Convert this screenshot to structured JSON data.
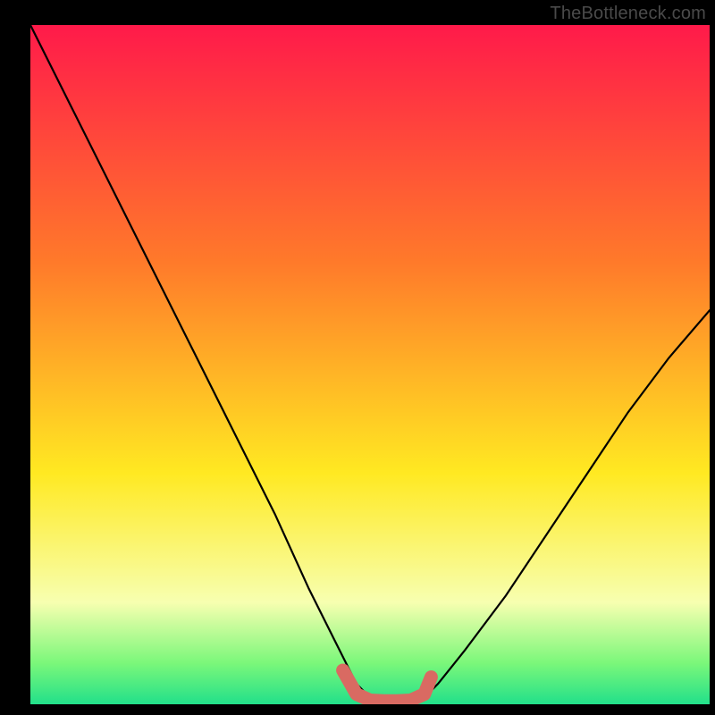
{
  "watermark": "TheBottleneck.com",
  "colors": {
    "frame": "#000000",
    "gradient_top": "#ff1a4a",
    "gradient_mid1": "#ff7a2a",
    "gradient_mid2": "#ffe922",
    "gradient_bottom1": "#f7ffb0",
    "gradient_bottom2": "#7af77a",
    "gradient_bottom3": "#22e08a",
    "curve": "#000000",
    "highlight": "#d96a62"
  },
  "chart_data": {
    "type": "line",
    "title": "",
    "xlabel": "",
    "ylabel": "",
    "xlim": [
      0,
      100
    ],
    "ylim": [
      0,
      100
    ],
    "series": [
      {
        "name": "bottleneck-curve",
        "x": [
          0,
          6,
          12,
          18,
          24,
          30,
          36,
          41,
          45,
          48,
          50,
          52,
          54,
          56,
          58,
          60,
          64,
          70,
          76,
          82,
          88,
          94,
          100
        ],
        "y": [
          100,
          88,
          76,
          64,
          52,
          40,
          28,
          17,
          9,
          3,
          1,
          0.5,
          0.5,
          0.5,
          1,
          3,
          8,
          16,
          25,
          34,
          43,
          51,
          58
        ]
      },
      {
        "name": "optimal-zone-highlight",
        "x": [
          46,
          48,
          50,
          52,
          54,
          56,
          58,
          59
        ],
        "y": [
          5,
          1.5,
          0.6,
          0.5,
          0.5,
          0.6,
          1.5,
          4
        ]
      }
    ],
    "annotations": []
  }
}
